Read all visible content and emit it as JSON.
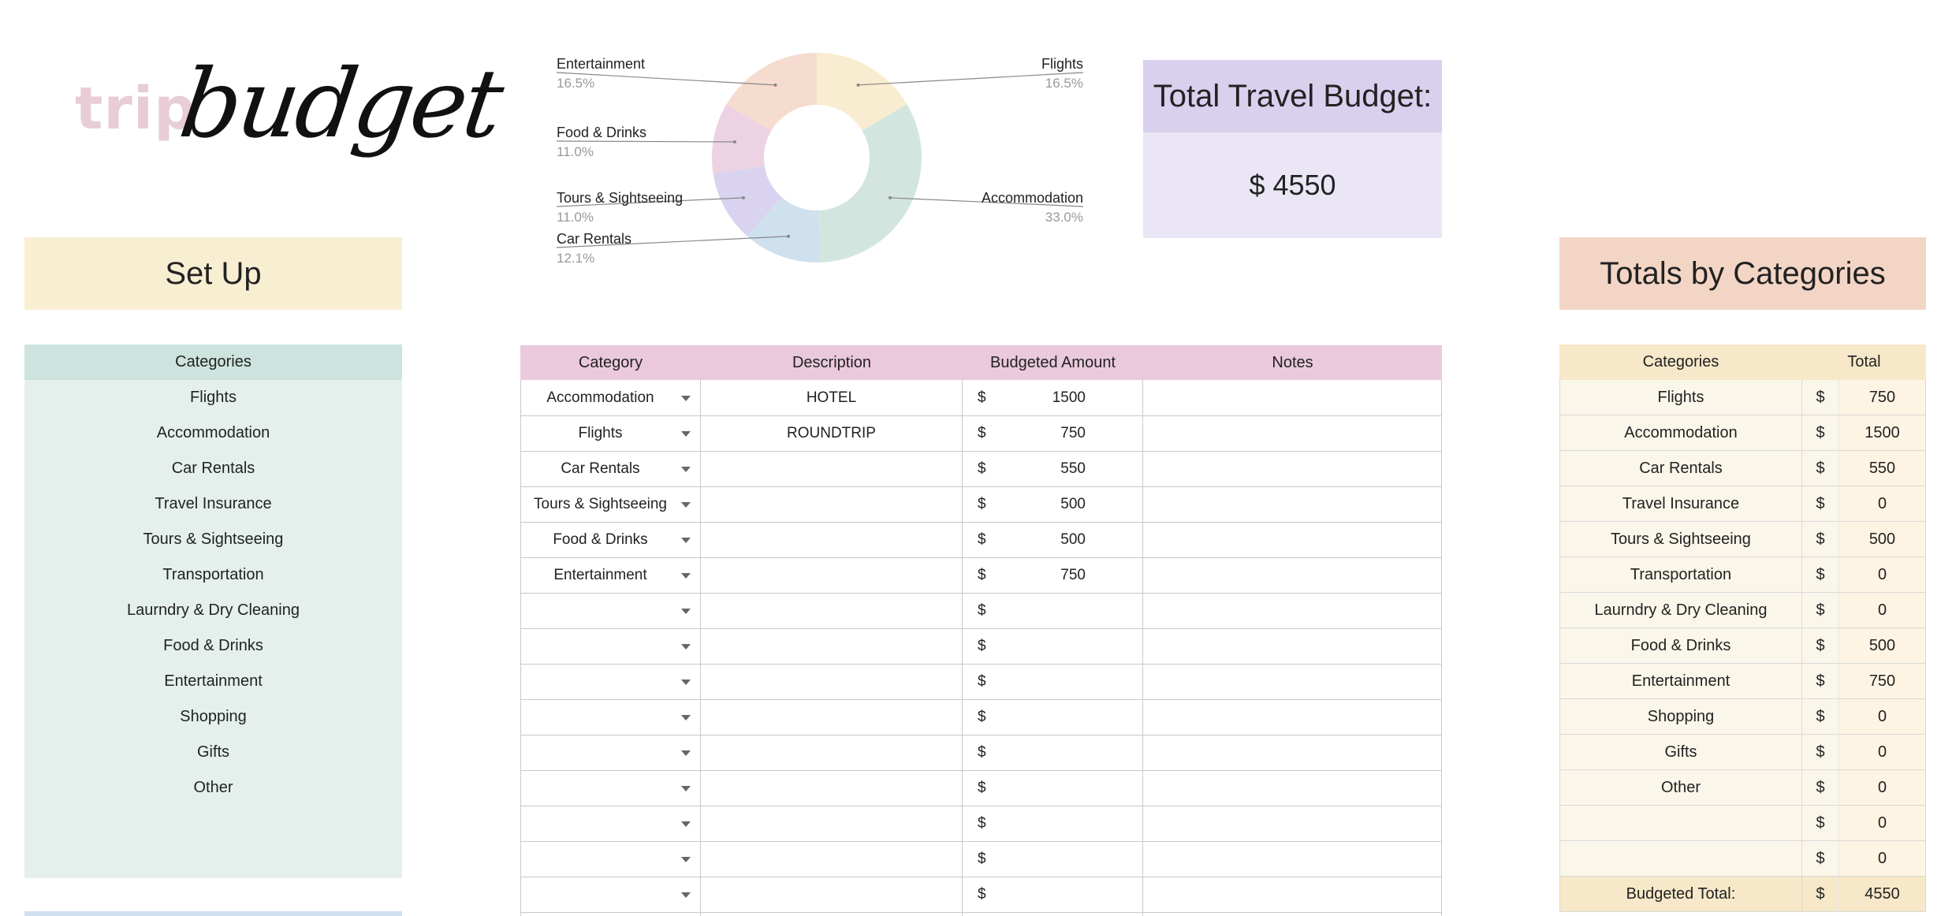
{
  "logo": {
    "word1": "trip",
    "word2": "budget"
  },
  "setup": {
    "title": "Set Up",
    "header": "Categories",
    "items": [
      "Flights",
      "Accommodation",
      "Car Rentals",
      "Travel Insurance",
      "Tours & Sightseeing",
      "Transportation",
      "Laurndry & Dry Cleaning",
      "Food & Drinks",
      "Entertainment",
      "Shopping",
      "Gifts",
      "Other"
    ]
  },
  "total_budget": {
    "title": "Total Travel Budget:",
    "value": "$ 4550"
  },
  "chart_data": {
    "type": "pie",
    "donut": true,
    "slices": [
      {
        "label": "Flights",
        "percent_label": "16.5%",
        "value": 750,
        "color": "#f8edd0"
      },
      {
        "label": "Accommodation",
        "percent_label": "33.0%",
        "value": 1500,
        "color": "#d2e6df"
      },
      {
        "label": "Car Rentals",
        "percent_label": "12.1%",
        "value": 550,
        "color": "#cfe0ef"
      },
      {
        "label": "Tours & Sightseeing",
        "percent_label": "11.0%",
        "value": 500,
        "color": "#dad3ef"
      },
      {
        "label": "Food & Drinks",
        "percent_label": "11.0%",
        "value": 500,
        "color": "#ecd2e3"
      },
      {
        "label": "Entertainment",
        "percent_label": "16.5%",
        "value": 750,
        "color": "#f5dccf"
      }
    ]
  },
  "expenses": {
    "headers": [
      "Category",
      "Description",
      "Budgeted Amount",
      "Notes"
    ],
    "currency": "$",
    "rows": [
      {
        "category": "Accommodation",
        "description": "HOTEL",
        "amount": "1500",
        "notes": ""
      },
      {
        "category": "Flights",
        "description": "ROUNDTRIP",
        "amount": "750",
        "notes": ""
      },
      {
        "category": "Car Rentals",
        "description": "",
        "amount": "550",
        "notes": ""
      },
      {
        "category": "Tours & Sightseeing",
        "description": "",
        "amount": "500",
        "notes": ""
      },
      {
        "category": "Food & Drinks",
        "description": "",
        "amount": "500",
        "notes": ""
      },
      {
        "category": "Entertainment",
        "description": "",
        "amount": "750",
        "notes": ""
      },
      {
        "category": "",
        "description": "",
        "amount": "",
        "notes": ""
      },
      {
        "category": "",
        "description": "",
        "amount": "",
        "notes": ""
      },
      {
        "category": "",
        "description": "",
        "amount": "",
        "notes": ""
      },
      {
        "category": "",
        "description": "",
        "amount": "",
        "notes": ""
      },
      {
        "category": "",
        "description": "",
        "amount": "",
        "notes": ""
      },
      {
        "category": "",
        "description": "",
        "amount": "",
        "notes": ""
      },
      {
        "category": "",
        "description": "",
        "amount": "",
        "notes": ""
      },
      {
        "category": "",
        "description": "",
        "amount": "",
        "notes": ""
      },
      {
        "category": "",
        "description": "",
        "amount": "",
        "notes": ""
      },
      {
        "category": "",
        "description": "",
        "amount": "",
        "notes": ""
      }
    ]
  },
  "totals": {
    "title": "Totals by Categories",
    "headers": [
      "Categories",
      "Total"
    ],
    "currency": "$",
    "rows": [
      {
        "category": "Flights",
        "total": "750"
      },
      {
        "category": "Accommodation",
        "total": "1500"
      },
      {
        "category": "Car Rentals",
        "total": "550"
      },
      {
        "category": "Travel Insurance",
        "total": "0"
      },
      {
        "category": "Tours & Sightseeing",
        "total": "500"
      },
      {
        "category": "Transportation",
        "total": "0"
      },
      {
        "category": "Laurndry & Dry Cleaning",
        "total": "0"
      },
      {
        "category": "Food & Drinks",
        "total": "500"
      },
      {
        "category": "Entertainment",
        "total": "750"
      },
      {
        "category": "Shopping",
        "total": "0"
      },
      {
        "category": "Gifts",
        "total": "0"
      },
      {
        "category": "Other",
        "total": "0"
      },
      {
        "category": "",
        "total": "0"
      },
      {
        "category": "",
        "total": "0"
      }
    ],
    "footer_label": "Budgeted Total:",
    "footer_total": "4550"
  }
}
